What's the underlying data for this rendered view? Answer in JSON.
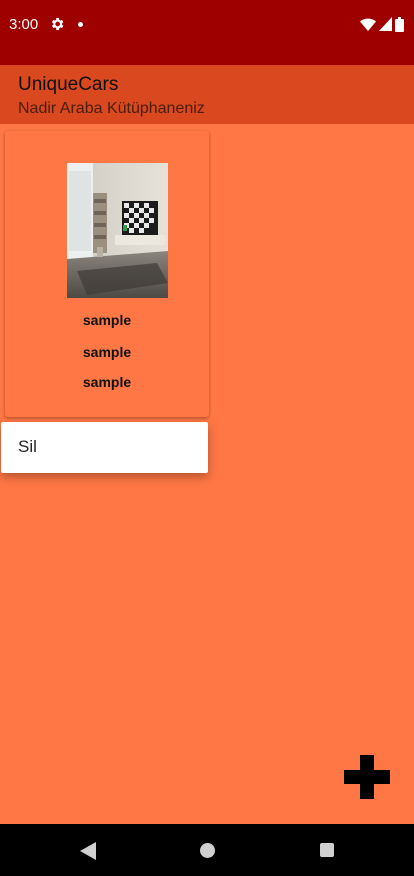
{
  "status_bar": {
    "time": "3:00",
    "icons_left": [
      "gear-icon",
      "notification-dot-icon"
    ],
    "icons_right": [
      "wifi-icon",
      "signal-icon",
      "battery-icon"
    ],
    "color": "#9e0000"
  },
  "app_bar": {
    "title": "UniqueCars",
    "subtitle": "Nadir Araba Kütüphaneniz",
    "color": "#d9481e"
  },
  "card": {
    "image_icon": "living-room-photo",
    "lines": [
      "sample",
      "sample",
      "sample"
    ]
  },
  "context_menu": {
    "items": [
      "Sil"
    ]
  },
  "fab": {
    "icon": "plus-icon"
  },
  "navigation": {
    "icons": [
      "back-icon",
      "home-icon",
      "recents-icon"
    ]
  },
  "colors": {
    "background": "#ff7744",
    "status_bar": "#9e0000",
    "app_bar": "#d9481e"
  }
}
